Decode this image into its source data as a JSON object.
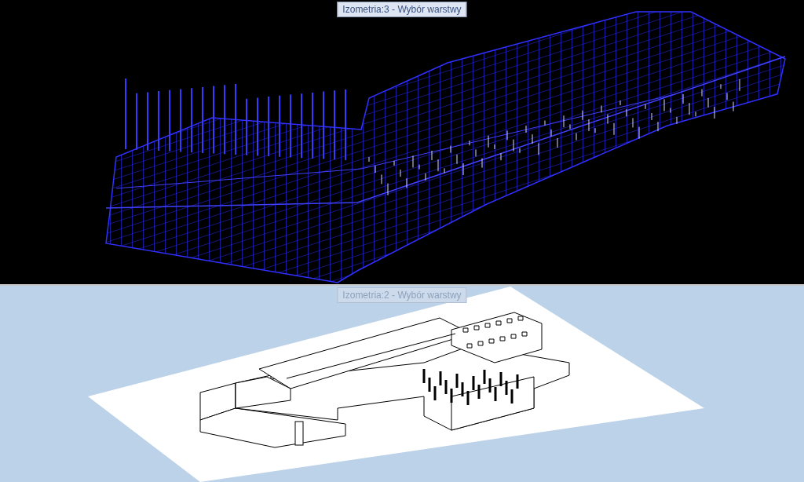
{
  "viewports": [
    {
      "title": "Izometria:3 - Wybór warstwy",
      "kind": "wireframe",
      "active": true
    },
    {
      "title": "Izometria:2 - Wybór warstwy",
      "kind": "shaded",
      "active": false
    }
  ]
}
